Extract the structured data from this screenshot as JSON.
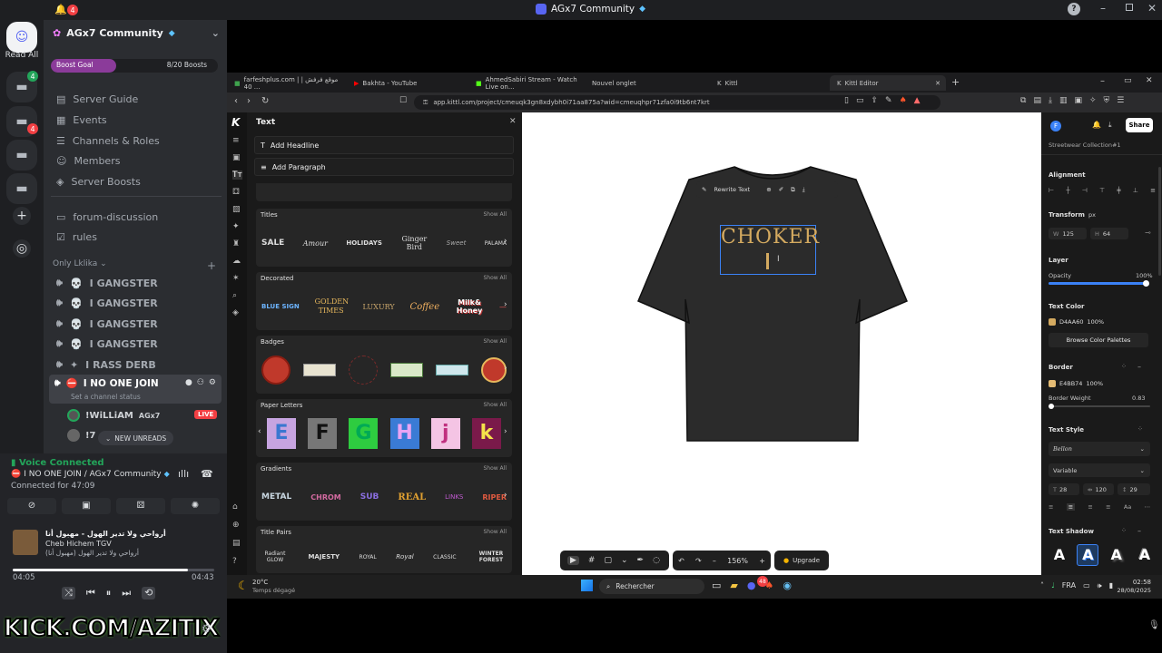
{
  "discord": {
    "window_title": "AGx7 Community",
    "notif_count": "4",
    "read_all": "Read All",
    "rail_badges": [
      "4",
      "4"
    ],
    "server_name": "AGx7 Community",
    "boost_goal_label": "Boost Goal",
    "boost_goal_value": "8/20 Boosts",
    "nav": [
      "Server Guide",
      "Events",
      "Channels & Roles",
      "Members",
      "Server Boosts"
    ],
    "text_channels": [
      "forum-discussion",
      "rules"
    ],
    "category": "Only Lklika",
    "voice_channels": [
      "I GANGSTER",
      "I GANGSTER",
      "I GANGSTER",
      "I GANGSTER",
      "I RASS DERB"
    ],
    "active_channel": "I NO ONE JOIN",
    "channel_status": "Set a channel status",
    "voice_user_1": "!WiLLiAM",
    "voice_user_1_tag": "AGx7",
    "live": "LIVE",
    "voice_user_2": "!7",
    "new_unreads": "NEW UNREADS",
    "voice_connected": "Voice Connected",
    "voice_path": "I NO ONE JOIN / AGx7 Community",
    "connected_for": "Connected for 47:09",
    "song_title": "أرواحي ولا تدير الهول - مهبول أنا",
    "song_artist": "Cheb Hichem TGV",
    "song_sub": "(مهبول أنا) أرواحي ولا تدير الهول",
    "time_cur": "04:05",
    "time_total": "04:43",
    "progress": 0.87,
    "overlay_text": "KICK.COM/AZITIX"
  },
  "browser": {
    "tabs": [
      "farfeshplus.com | موقع فرفش | 40 ...",
      "Bakhta - YouTube",
      "AhmedSabiri Stream - Watch Live on...",
      "Nouvel onglet",
      "Kittl",
      "Kittl Editor"
    ],
    "url": "app.kittl.com/project/cmeuqk3gn8xdybh0i71aa875a?wid=cmeuqhpr71zfa0i9tb6nt7krt"
  },
  "kittl": {
    "panel_title": "Text",
    "add_headline": "Add Headline",
    "add_paragraph": "Add Paragraph",
    "show_all": "Show All",
    "sections": [
      {
        "label": "Titles",
        "thumbs": [
          "SALE",
          "Amour",
          "HOLIDAYS",
          "Ginger Bird",
          "Sweet",
          "PALAMA"
        ]
      },
      {
        "label": "Decorated",
        "thumbs": [
          "BLUE SIGN",
          "GOLDEN TIMES",
          "LUXURY",
          "Coffee",
          "Milk& Honey",
          "—"
        ]
      },
      {
        "label": "Badges",
        "thumbs": [
          "",
          "",
          "",
          "",
          "",
          ""
        ]
      },
      {
        "label": "Paper Letters",
        "thumbs": [
          "E",
          "F",
          "G",
          "H",
          "j",
          "k"
        ]
      },
      {
        "label": "Gradients",
        "thumbs": [
          "METAL",
          "CHROM",
          "SUB",
          "REAL",
          "LINKS",
          "RIPER"
        ]
      },
      {
        "label": "Title Pairs",
        "thumbs": [
          "Radiant GLOW",
          "MAJESTY",
          "ROYAL",
          "Royal",
          "CLASSIC",
          "WINTER FOREST"
        ]
      }
    ],
    "rewrite_text": "Rewrite Text",
    "canvas_text": "CHOKER",
    "canvas_text_color": "#D4AA60",
    "tshirt_color": "#2b2b2b",
    "zoom": "156%",
    "upgrade": "Upgrade",
    "share": "Share",
    "project_name": "Streetwear Collection#1",
    "alignment": "Alignment",
    "transform": "Transform",
    "transform_unit": "px",
    "w_label": "W",
    "w_value": "125",
    "h_label": "H",
    "h_value": "64",
    "layer": "Layer",
    "opacity_label": "Opacity",
    "opacity_value": "100%",
    "text_color_label": "Text Color",
    "text_color_hex": "D4AA60",
    "text_color_pct": "100%",
    "browse_palettes": "Browse Color Palettes",
    "border_label": "Border",
    "border_hex": "E4BB74",
    "border_pct": "100%",
    "border_weight_label": "Border Weight",
    "border_weight_value": "0.83",
    "text_style_label": "Text Style",
    "font_name": "Bellon",
    "font_weight": "Variable",
    "font_size": "28",
    "letter_spacing": "120",
    "line_height": "29",
    "text_shadow_label": "Text Shadow"
  },
  "taskbar": {
    "weather_temp": "20°C",
    "weather_text": "Temps dégagé",
    "search": "Rechercher",
    "lang": "FRA",
    "time": "02:58",
    "date": "28/08/2025",
    "app_badge": "48"
  }
}
